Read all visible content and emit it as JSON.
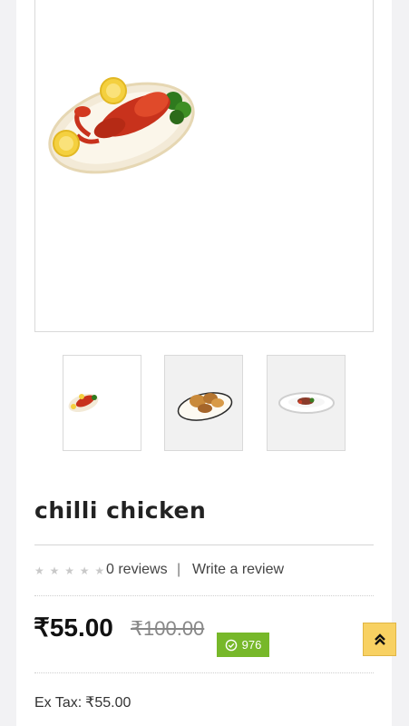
{
  "product": {
    "name": "chilli chicken",
    "images": {
      "main": "lobster-dish-image",
      "thumbnails": [
        "lobster-dish-thumbnail",
        "fried-chicken-dish-thumbnail",
        "plated-dish-thumbnail"
      ]
    }
  },
  "rating": {
    "stars_filled": 0,
    "stars_total": 5,
    "reviews_label": "0 reviews",
    "separator": "|",
    "write_review_label": "Write a review"
  },
  "pricing": {
    "price": "₹55.00",
    "old_price": "₹100.00",
    "points": "976",
    "ex_tax_label": "Ex Tax:",
    "ex_tax_value": "₹55.00"
  },
  "ui": {
    "star_icon": "★",
    "scroll_top_icon": "double-chevron-up-icon",
    "badge_color": "#77b82a",
    "scroll_button_color": "#f8d162"
  }
}
